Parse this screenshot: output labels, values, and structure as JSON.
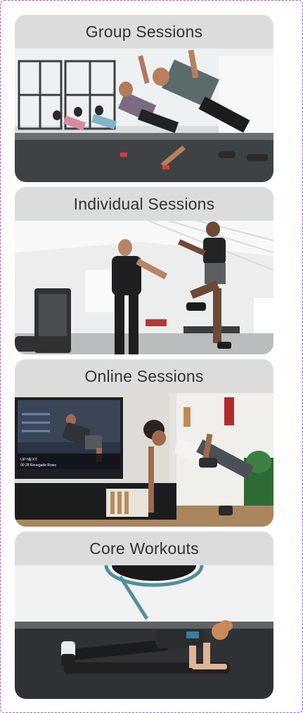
{
  "cards": [
    {
      "title": "Group Sessions",
      "image": "group-workout-photo"
    },
    {
      "title": "Individual Sessions",
      "image": "personal-trainer-photo"
    },
    {
      "title": "Online Sessions",
      "image": "online-workout-photo"
    },
    {
      "title": "Core Workouts",
      "image": "plank-workout-photo"
    }
  ],
  "online_screen": {
    "overlay_line1": "UP NEXT:",
    "overlay_line2": "00:28 Renegade Rows"
  },
  "colors": {
    "frame_border": "#9b59e0",
    "card_header_bg": "#dcdcdc",
    "card_title_text": "#333333"
  }
}
